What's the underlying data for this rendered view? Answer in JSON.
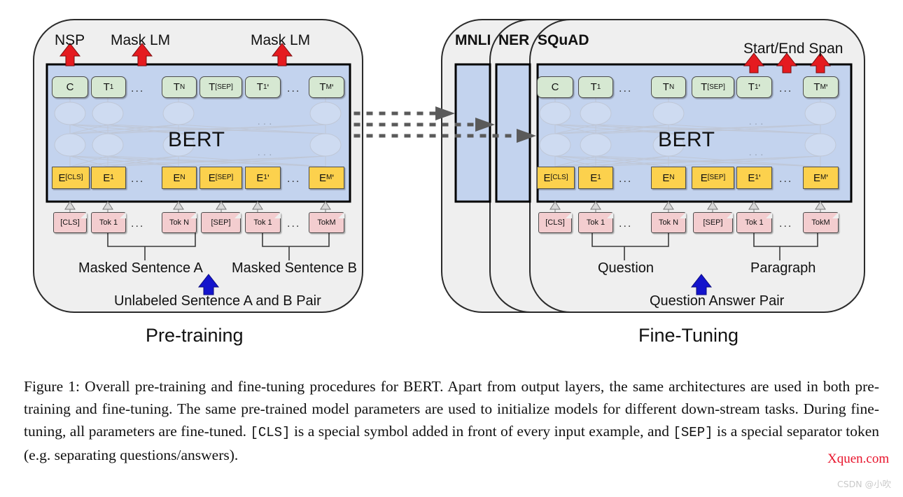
{
  "figure": {
    "pretraining": {
      "phase_label": "Pre-training",
      "outputs": [
        {
          "label": "NSP"
        },
        {
          "label": "Mask LM"
        },
        {
          "label": "Mask LM"
        }
      ],
      "model_label": "BERT",
      "output_tokens": [
        "C",
        "T₁",
        "…",
        "Tₙ",
        "T[SEP]",
        "T₁'",
        "…",
        "Tₘ'"
      ],
      "embeddings": [
        "E[CLS]",
        "E₁",
        "…",
        "Eₙ",
        "E[SEP]",
        "E₁'",
        "…",
        "Eₘ'"
      ],
      "input_tokens": [
        "[CLS]",
        "Tok 1",
        "…",
        "Tok N",
        "[SEP]",
        "Tok 1",
        "…",
        "TokM"
      ],
      "group_labels": [
        "Masked Sentence A",
        "Masked Sentence B"
      ],
      "input_source_label": "Unlabeled Sentence A and B Pair"
    },
    "finetuning": {
      "phase_label": "Fine-Tuning",
      "task_tabs": [
        "MNLI",
        "NER",
        "SQuAD"
      ],
      "output_label": "Start/End Span",
      "model_label": "BERT",
      "output_tokens": [
        "C",
        "T₁",
        "…",
        "Tₙ",
        "T[SEP]",
        "T₁'",
        "…",
        "Tₘ'"
      ],
      "embeddings": [
        "E[CLS]",
        "E₁",
        "…",
        "Eₙ",
        "E[SEP]",
        "E₁'",
        "…",
        "Eₘ'"
      ],
      "input_tokens": [
        "[CLS]",
        "Tok 1",
        "…",
        "Tok N",
        "[SEP]",
        "Tok 1",
        "…",
        "TokM"
      ],
      "group_labels": [
        "Question",
        "Paragraph"
      ],
      "input_source_label": "Question Answer Pair"
    },
    "colors": {
      "panel_bg": "#efefef",
      "bert_bg": "#c3d3ee",
      "output_chip": "#d6e8d2",
      "embedding_chip": "#fcd14d",
      "token_chip": "#f3cdcf",
      "red_arrow": "#e51b20",
      "blue_arrow": "#1414cc",
      "gray_arrow": "#d4d4d4",
      "transfer_arrow": "#5a5a5a"
    }
  },
  "caption": {
    "segments": [
      {
        "t": "Figure 1: Overall pre-training and fine-tuning procedures for BERT. Apart from output layers, the same architectures are used in both pre-training and fine-tuning. The same pre-trained model parameters are used to initialize models for different down-stream tasks. During fine-tuning, all parameters are fine-tuned. ",
        "mono": false
      },
      {
        "t": "[CLS]",
        "mono": true
      },
      {
        "t": " is a special symbol added in front of every input example, and ",
        "mono": false
      },
      {
        "t": "[SEP]",
        "mono": true
      },
      {
        "t": " is a special separator token (e.g. separating questions/answers).",
        "mono": false
      }
    ],
    "full_text": "Figure 1: Overall pre-training and fine-tuning procedures for BERT. Apart from output layers, the same architectures are used in both pre-training and fine-tuning. The same pre-trained model parameters are used to initialize models for different down-stream tasks. During fine-tuning, all parameters are fine-tuned. [CLS] is a special symbol added in front of every input example, and [SEP] is a special separator token (e.g. separating questions/answers)."
  },
  "watermarks": {
    "red_url": "Xquen.com",
    "csdn": "CSDN @小吹"
  }
}
